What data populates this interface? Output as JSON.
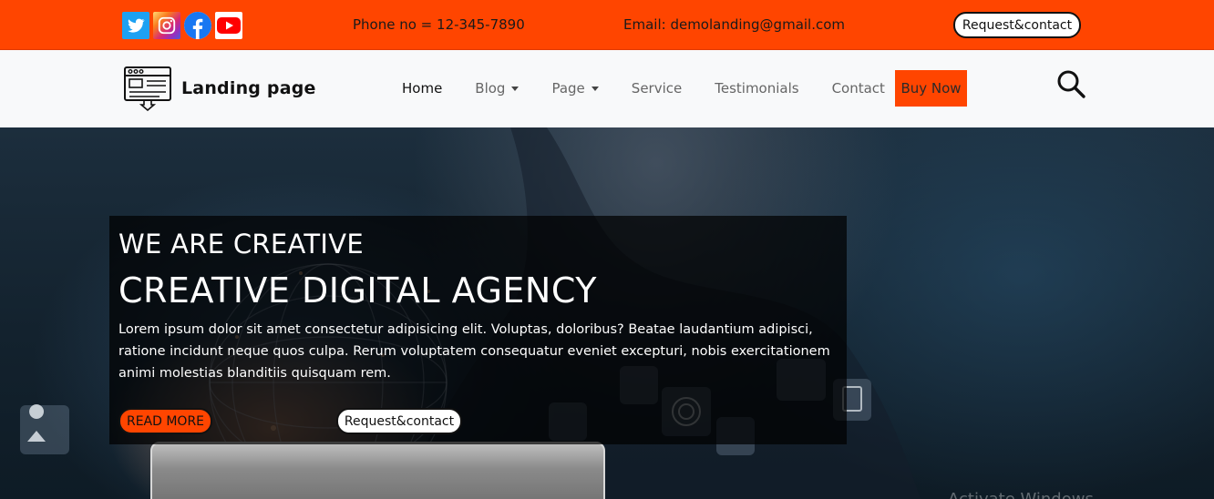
{
  "topbar": {
    "social": [
      "twitter-icon",
      "instagram-icon",
      "facebook-icon",
      "youtube-icon"
    ],
    "phone": "Phone no = 12-345-7890",
    "email": "Email: demolanding@gmail.com",
    "request_label": "Request&contact"
  },
  "navbar": {
    "brand_name": "Landing page",
    "items": [
      {
        "label": "Home",
        "active": true
      },
      {
        "label": "Blog",
        "dropdown": true
      },
      {
        "label": "Page",
        "dropdown": true
      },
      {
        "label": "Service"
      },
      {
        "label": "Testimonials"
      },
      {
        "label": "Contact"
      }
    ],
    "buy_label": "Buy Now"
  },
  "hero": {
    "subtitle": "WE ARE CREATIVE",
    "title": "CREATIVE DIGITAL AGENCY",
    "description": "Lorem ipsum dolor sit amet consectetur adipisicing elit. Voluptas, doloribus? Beatae laudantium adipisci, ratione incidunt neque quos culpa. Rerum voluptatem consequatur eveniet excepturi, nobis exercitationem animi molestias blanditiis quisquam rem.",
    "read_more_label": "READ MORE",
    "request_label": "Request&contact",
    "watermark": "Activate Windows"
  },
  "colors": {
    "accent": "#ff4500",
    "navbar_bg": "#f8f9fa"
  }
}
